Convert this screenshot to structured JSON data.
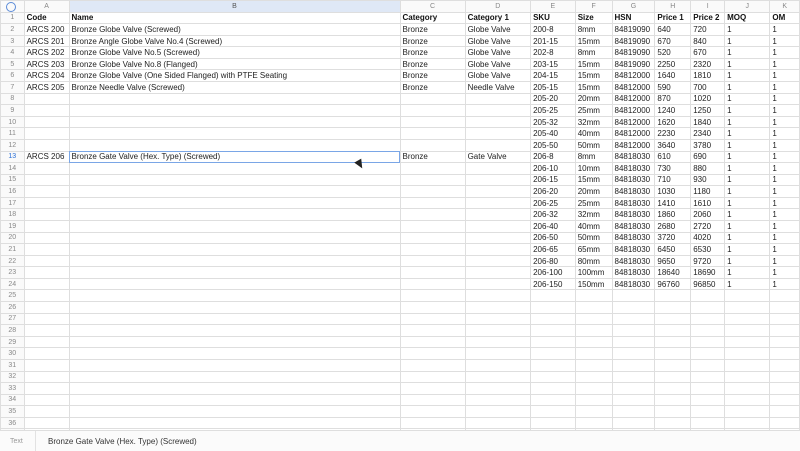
{
  "columns": [
    "A",
    "B",
    "C",
    "D",
    "E",
    "F",
    "G",
    "H",
    "I",
    "J",
    "K"
  ],
  "selected_column": "B",
  "selected_row": 13,
  "rows": [
    [
      "Code",
      "Name",
      "Category",
      "Category 1",
      "SKU",
      "Size",
      "HSN",
      "Price 1",
      "Price 2",
      "MOQ",
      "OM"
    ],
    [
      "ARCS 200",
      "Bronze Globe Valve (Screwed)",
      "Bronze",
      "Globe Valve",
      "200-8",
      "8mm",
      "84819090",
      "640",
      "720",
      "1",
      "1"
    ],
    [
      "ARCS 201",
      "Bronze Angle Globe Valve No.4 (Screwed)",
      "Bronze",
      "Globe Valve",
      "201-15",
      "15mm",
      "84819090",
      "670",
      "840",
      "1",
      "1"
    ],
    [
      "ARCS 202",
      "Bronze Globe Valve No.5 (Screwed)",
      "Bronze",
      "Globe Valve",
      "202-8",
      "8mm",
      "84819090",
      "520",
      "670",
      "1",
      "1"
    ],
    [
      "ARCS 203",
      "Bronze Globe Valve No.8 (Flanged)",
      "Bronze",
      "Globe Valve",
      "203-15",
      "15mm",
      "84819090",
      "2250",
      "2320",
      "1",
      "1"
    ],
    [
      "ARCS 204",
      "Bronze Globe Valve (One Sided Flanged) with PTFE Seating",
      "Bronze",
      "Globe Valve",
      "204-15",
      "15mm",
      "84812000",
      "1640",
      "1810",
      "1",
      "1"
    ],
    [
      "ARCS 205",
      "Bronze Needle Valve (Screwed)",
      "Bronze",
      "Needle Valve",
      "205-15",
      "15mm",
      "84812000",
      "590",
      "700",
      "1",
      "1"
    ],
    [
      "",
      "",
      "",
      "",
      "205-20",
      "20mm",
      "84812000",
      "870",
      "1020",
      "1",
      "1"
    ],
    [
      "",
      "",
      "",
      "",
      "205-25",
      "25mm",
      "84812000",
      "1240",
      "1250",
      "1",
      "1"
    ],
    [
      "",
      "",
      "",
      "",
      "205-32",
      "32mm",
      "84812000",
      "1620",
      "1840",
      "1",
      "1"
    ],
    [
      "",
      "",
      "",
      "",
      "205-40",
      "40mm",
      "84812000",
      "2230",
      "2340",
      "1",
      "1"
    ],
    [
      "",
      "",
      "",
      "",
      "205-50",
      "50mm",
      "84812000",
      "3640",
      "3780",
      "1",
      "1"
    ],
    [
      "ARCS 206",
      "Bronze Gate Valve (Hex. Type) (Screwed)",
      "Bronze",
      "Gate Valve",
      "206-8",
      "8mm",
      "84818030",
      "610",
      "690",
      "1",
      "1"
    ],
    [
      "",
      "",
      "",
      "",
      "206-10",
      "10mm",
      "84818030",
      "730",
      "880",
      "1",
      "1"
    ],
    [
      "",
      "",
      "",
      "",
      "206-15",
      "15mm",
      "84818030",
      "710",
      "930",
      "1",
      "1"
    ],
    [
      "",
      "",
      "",
      "",
      "206-20",
      "20mm",
      "84818030",
      "1030",
      "1180",
      "1",
      "1"
    ],
    [
      "",
      "",
      "",
      "",
      "206-25",
      "25mm",
      "84818030",
      "1410",
      "1610",
      "1",
      "1"
    ],
    [
      "",
      "",
      "",
      "",
      "206-32",
      "32mm",
      "84818030",
      "1860",
      "2060",
      "1",
      "1"
    ],
    [
      "",
      "",
      "",
      "",
      "206-40",
      "40mm",
      "84818030",
      "2680",
      "2720",
      "1",
      "1"
    ],
    [
      "",
      "",
      "",
      "",
      "206-50",
      "50mm",
      "84818030",
      "3720",
      "4020",
      "1",
      "1"
    ],
    [
      "",
      "",
      "",
      "",
      "206-65",
      "65mm",
      "84818030",
      "6450",
      "6530",
      "1",
      "1"
    ],
    [
      "",
      "",
      "",
      "",
      "206-80",
      "80mm",
      "84818030",
      "9650",
      "9720",
      "1",
      "1"
    ],
    [
      "",
      "",
      "",
      "",
      "206-100",
      "100mm",
      "84818030",
      "18640",
      "18690",
      "1",
      "1"
    ],
    [
      "",
      "",
      "",
      "",
      "206-150",
      "150mm",
      "84818030",
      "96760",
      "96850",
      "1",
      "1"
    ]
  ],
  "total_rows": 38,
  "formula_bar": {
    "type_label": "Text",
    "value": "Bronze Gate Valve (Hex. Type) (Screwed)"
  },
  "colors": {
    "selection_outline": "#7aa6e6",
    "header_highlight": "#dfe8f6",
    "selected_row_number": "#2a6fd6"
  }
}
